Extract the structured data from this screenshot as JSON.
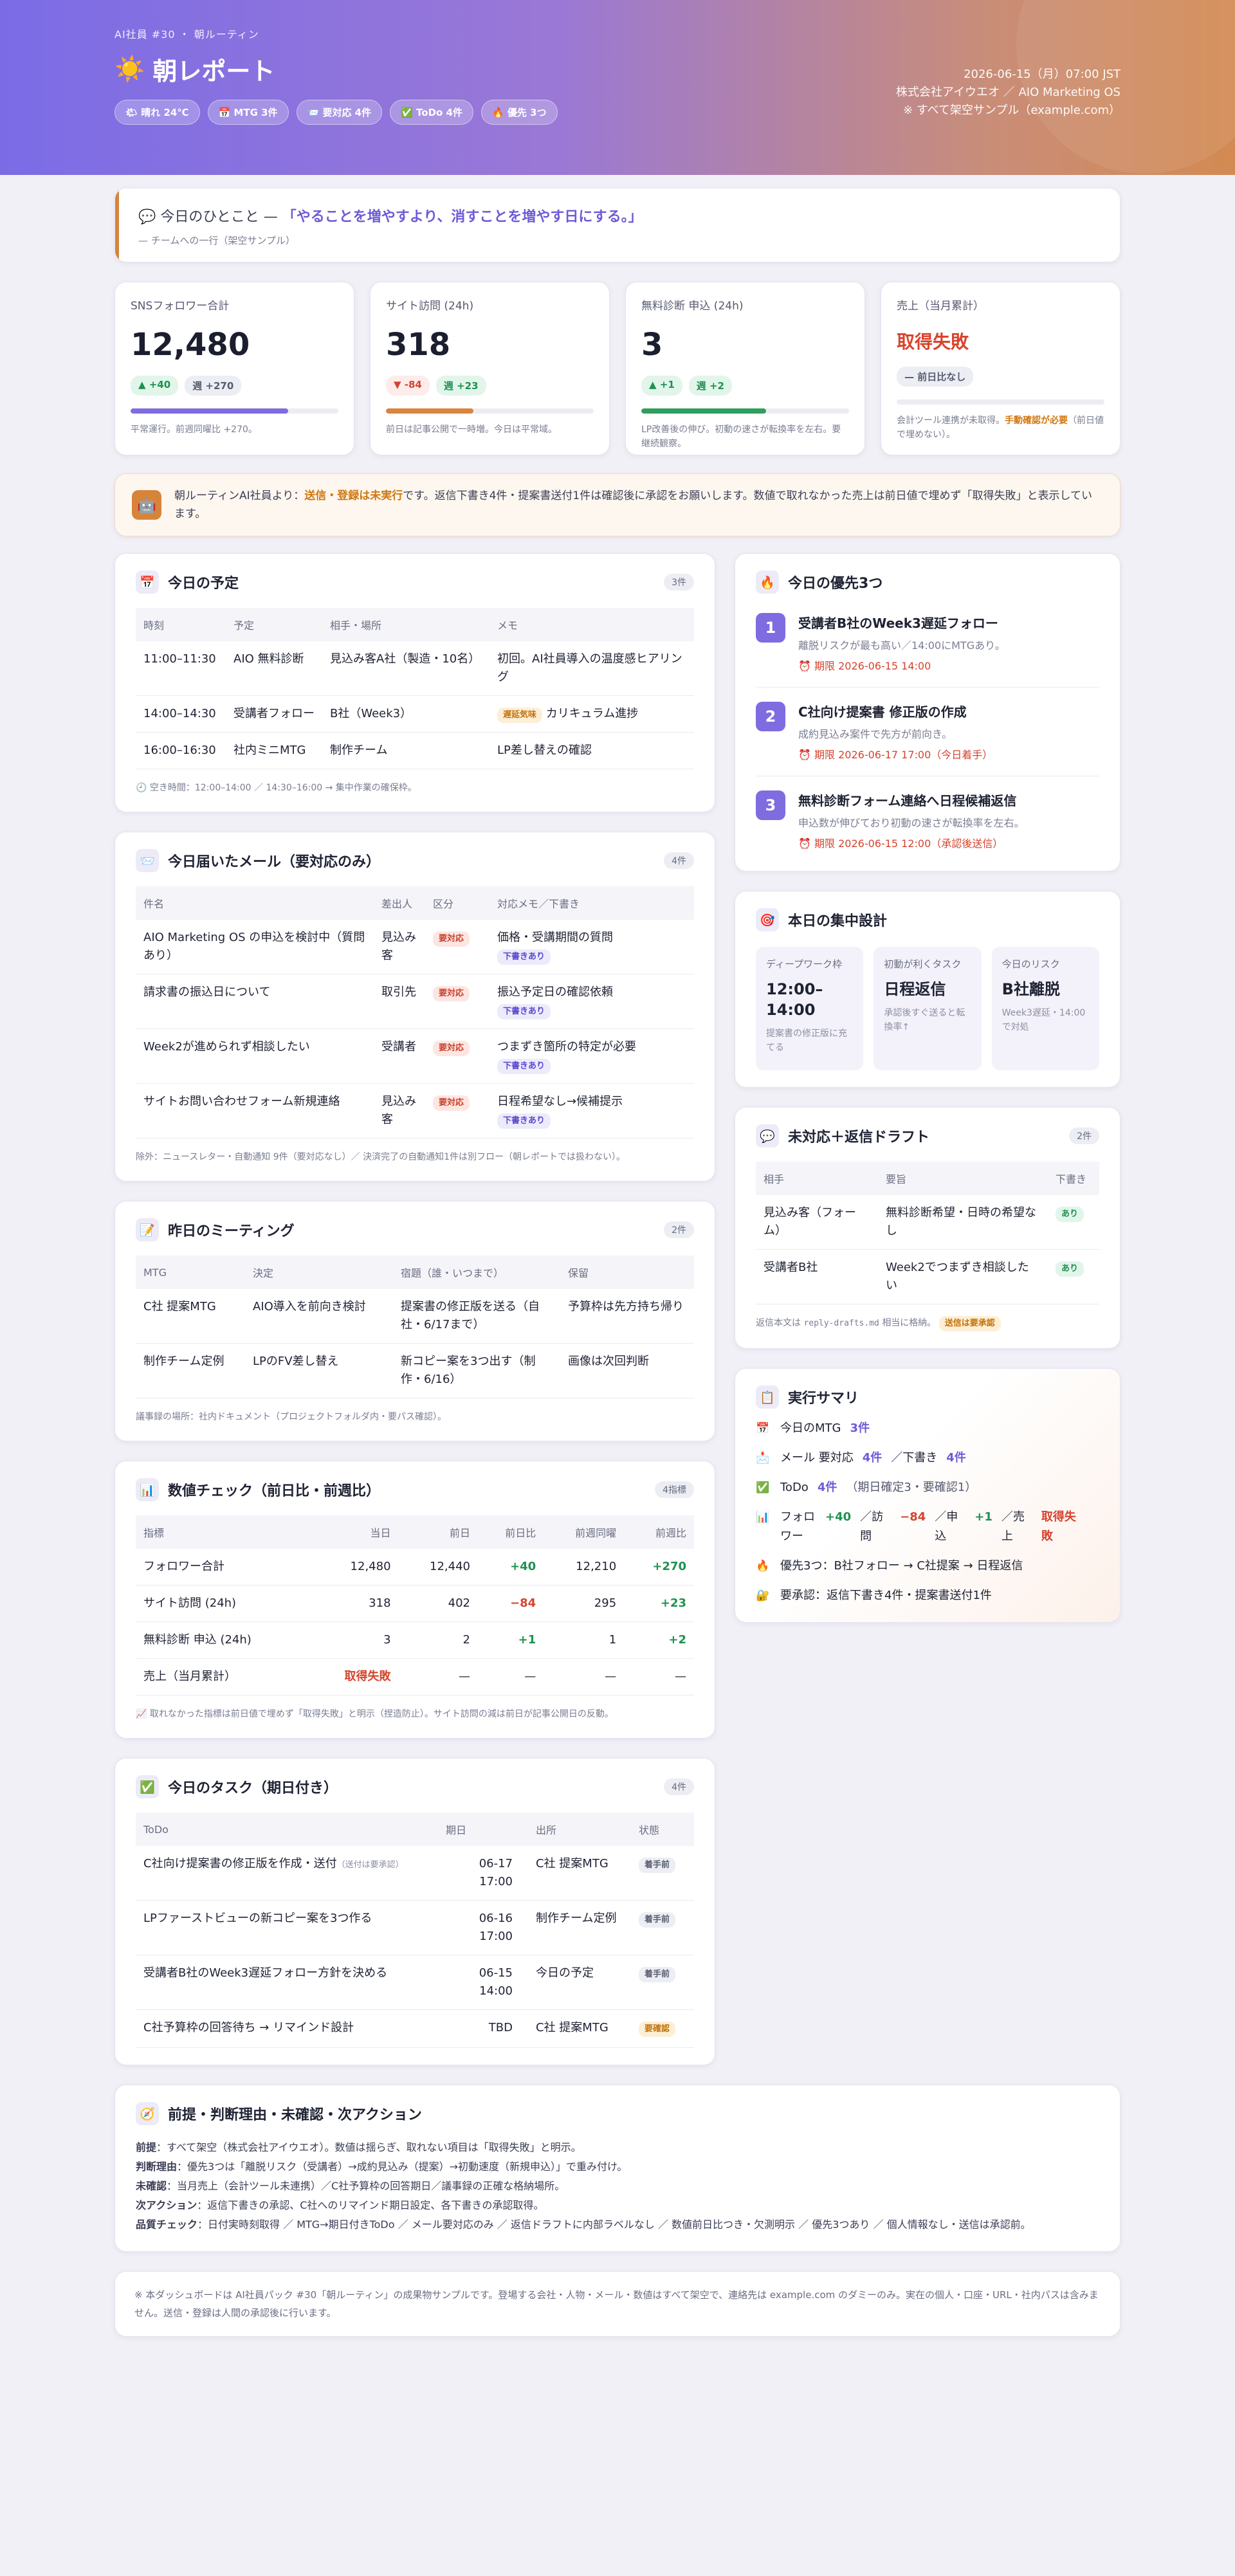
{
  "hero": {
    "eyebrow": "AI社員 #30 ・ 朝ルーティン",
    "title_icon": "☀️",
    "title": "朝レポート",
    "chips": [
      "🌤 晴れ 24℃",
      "📅 MTG 3件",
      "📨 要対応 4件",
      "✅ ToDo 4件",
      "🔥 優先 3つ"
    ],
    "meta": [
      "2026-06-15（月）07:00 JST",
      "株式会社アイウエオ ／ AIO Marketing OS",
      "※ すべて架空サンプル（example.com）"
    ]
  },
  "quote": {
    "lead": "💬 今日のひとこと — ",
    "text": "「やることを増やすより、消すことを増やす日にする。」",
    "sub": "— チームへの一行（架空サンプル）"
  },
  "kpis": [
    {
      "label": "SNSフォロワー合計",
      "value": "12,480",
      "badge1": "▲ +40",
      "badge1_type": "up",
      "badge2": "週 +270",
      "bar_pct": 76,
      "bar_color": "#7e6ce0",
      "note": "平常運行。前週同曜比 +270。"
    },
    {
      "label": "サイト訪問 (24h)",
      "value": "318",
      "badge1": "▼ -84",
      "badge1_type": "down",
      "badge2": "週 +23",
      "bar_pct": 42,
      "bar_color": "#d9843f",
      "note": "前日は記事公開で一時増。今日は平常域。"
    },
    {
      "label": "無料診断 申込 (24h)",
      "value": "3",
      "badge1": "▲ +1",
      "badge1_type": "up",
      "badge2": "週 +2",
      "bar_pct": 60,
      "bar_color": "#2f9e5e",
      "note": "LP改善後の伸び。初動の速さが転換率を左右。要継続観察。"
    },
    {
      "label": "売上（当月累計）",
      "value": "取得失敗",
      "badge1": "— 前日比なし",
      "bar_pct": 0,
      "bar_color": "#cccccc",
      "note_pre": "会計ツール連携が未取得。",
      "note_bold": "手動確認が必要",
      "note_post": "（前日値で埋めない）。"
    }
  ],
  "notice": {
    "icon": "🤖",
    "pre": "朝ルーティンAI社員より：",
    "bold": "送信・登録は未実行",
    "post": "です。返信下書き4件・提案書送付1件は確認後に承認をお願いします。数値で取れなかった売上は前日値で埋めず「取得失敗」と表示しています。"
  },
  "schedule": {
    "icon": "📅",
    "title": "今日の予定",
    "count": "3件",
    "headers": [
      "時刻",
      "予定",
      "相手・場所",
      "メモ"
    ],
    "rows": [
      {
        "time": "11:00–11:30",
        "event": "AIO 無料診断",
        "who": "見込み客A社（製造・10名）",
        "tag": "",
        "memo": "初回。AI社員導入の温度感ヒアリング"
      },
      {
        "time": "14:00–14:30",
        "event": "受講者フォロー",
        "who": "B社（Week3）",
        "tag": "遅延気味",
        "memo": "カリキュラム進捗"
      },
      {
        "time": "16:00–16:30",
        "event": "社内ミニMTG",
        "who": "制作チーム",
        "tag": "",
        "memo": "LP差し替えの確認"
      }
    ],
    "footnote": "🕘 空き時間：12:00–14:00 ／ 14:30–16:00 → 集中作業の確保枠。"
  },
  "mail": {
    "icon": "📨",
    "title": "今日届いたメール（要対応のみ）",
    "count": "4件",
    "headers": [
      "件名",
      "差出人",
      "区分",
      "対応メモ／下書き"
    ],
    "rows": [
      {
        "subject": "AIO Marketing OS の申込を検討中（質問あり）",
        "from": "見込み客",
        "kind": "要対応",
        "memo": "価格・受講期間の質問",
        "draft": "下書きあり"
      },
      {
        "subject": "請求書の振込日について",
        "from": "取引先",
        "kind": "要対応",
        "memo": "振込予定日の確認依頼",
        "draft": "下書きあり"
      },
      {
        "subject": "Week2が進められず相談したい",
        "from": "受講者",
        "kind": "要対応",
        "memo": "つまずき箇所の特定が必要",
        "draft": "下書きあり"
      },
      {
        "subject": "サイトお問い合わせフォーム新規連絡",
        "from": "見込み客",
        "kind": "要対応",
        "memo": "日程希望なし→候補提示",
        "draft": "下書きあり"
      }
    ],
    "footnote": "除外：ニュースレター・自動通知 9件（要対応なし）／ 決済完了の自動通知1件は別フロー（朝レポートでは扱わない）。"
  },
  "meetings": {
    "icon": "📝",
    "title": "昨日のミーティング",
    "count": "2件",
    "headers": [
      "MTG",
      "決定",
      "宿題（誰・いつまで）",
      "保留"
    ],
    "rows": [
      {
        "mtg": "C社 提案MTG",
        "decision": "AIO導入を前向き検討",
        "homework": "提案書の修正版を送る（自社・6/17まで）",
        "hold": "予算枠は先方持ち帰り"
      },
      {
        "mtg": "制作チーム定例",
        "decision": "LPのFV差し替え",
        "homework": "新コピー案を3つ出す（制作・6/16）",
        "hold": "画像は次回判断"
      }
    ],
    "footnote": "議事録の場所：社内ドキュメント（プロジェクトフォルダ内・要パス確認）。"
  },
  "metrics": {
    "icon": "📊",
    "title": "数値チェック（前日比・前週比）",
    "count": "4指標",
    "headers": [
      "指標",
      "当日",
      "前日",
      "前日比",
      "前週同曜",
      "前週比"
    ],
    "rows": [
      {
        "name": "フォロワー合計",
        "today": "12,480",
        "prev": "12,440",
        "dd": "+40",
        "dd_c": "g",
        "week": "12,210",
        "ww": "+270",
        "ww_c": "g"
      },
      {
        "name": "サイト訪問 (24h)",
        "today": "318",
        "prev": "402",
        "dd": "−84",
        "dd_c": "r",
        "week": "295",
        "ww": "+23",
        "ww_c": "g"
      },
      {
        "name": "無料診断 申込 (24h)",
        "today": "3",
        "prev": "2",
        "dd": "+1",
        "dd_c": "g",
        "week": "1",
        "ww": "+2",
        "ww_c": "g"
      },
      {
        "name": "売上（当月累計）",
        "today": "取得失敗",
        "today_c": "r",
        "prev": "—",
        "dd": "—",
        "dd_c": "",
        "week": "—",
        "ww": "—",
        "ww_c": ""
      }
    ],
    "footnote": "📈 取れなかった指標は前日値で埋めず「取得失敗」と明示（捏造防止）。サイト訪問の減は前日が記事公開日の反動。"
  },
  "tasks": {
    "icon": "✅",
    "title": "今日のタスク（期日付き）",
    "count": "4件",
    "headers": [
      "ToDo",
      "期日",
      "出所",
      "状態"
    ],
    "rows": [
      {
        "todo": "C社向け提案書の修正版を作成・送付",
        "todo_sub": "（送付は要承認）",
        "due": "06-17 17:00",
        "src": "C社 提案MTG",
        "state": "着手前",
        "state_c": "s"
      },
      {
        "todo": "LPファーストビューの新コピー案を3つ作る",
        "todo_sub": "",
        "due": "06-16 17:00",
        "src": "制作チーム定例",
        "state": "着手前",
        "state_c": "s"
      },
      {
        "todo": "受講者B社のWeek3遅延フォロー方針を決める",
        "todo_sub": "",
        "due": "06-15 14:00",
        "src": "今日の予定",
        "state": "着手前",
        "state_c": "s"
      },
      {
        "todo": "C社予算枠の回答待ち → リマインド設計",
        "todo_sub": "",
        "due": "TBD",
        "src": "C社 提案MTG",
        "state": "要確認",
        "state_c": "y"
      }
    ]
  },
  "priorities": {
    "icon": "🔥",
    "title": "今日の優先3つ",
    "items": [
      {
        "num": "1",
        "title": "受講者B社のWeek3遅延フォロー",
        "desc": "離脱リスクが最も高い／14:00にMTGあり。",
        "limit": "⏰ 期限 2026-06-15 14:00"
      },
      {
        "num": "2",
        "title": "C社向け提案書 修正版の作成",
        "desc": "成約見込み案件で先方が前向き。",
        "limit": "⏰ 期限 2026-06-17 17:00（今日着手）"
      },
      {
        "num": "3",
        "title": "無料診断フォーム連絡へ日程候補返信",
        "desc": "申込数が伸びており初動の速さが転換率を左右。",
        "limit": "⏰ 期限 2026-06-15 12:00（承認後送信）"
      }
    ]
  },
  "focus": {
    "icon": "🎯",
    "title": "本日の集中設計",
    "boxes": [
      {
        "label": "ディープワーク枠",
        "value": "12:00–14:00",
        "note": "提案書の修正版に充てる"
      },
      {
        "label": "初動が利くタスク",
        "value": "日程返信",
        "note": "承認後すぐ送ると転換率↑"
      },
      {
        "label": "今日のリスク",
        "value": "B社離脱",
        "note": "Week3遅延・14:00で対処"
      }
    ]
  },
  "drafts": {
    "icon": "💬",
    "title": "未対応＋返信ドラフト",
    "count": "2件",
    "headers": [
      "相手",
      "要旨",
      "下書き"
    ],
    "rows": [
      {
        "who": "見込み客（フォーム）",
        "gist": "無料診断希望・日時の希望なし",
        "draft": "あり"
      },
      {
        "who": "受講者B社",
        "gist": "Week2でつまずき相談したい",
        "draft": "あり"
      }
    ],
    "foot_pre": "返信本文は",
    "foot_mono": "reply-drafts.md",
    "foot_post": "相当に格納。",
    "foot_tag": "送信は要承認"
  },
  "summary": {
    "icon": "📋",
    "title": "実行サマリ",
    "mtg": {
      "icon": "📅",
      "label": "今日のMTG",
      "value": "3件"
    },
    "mail": {
      "icon": "📩",
      "label": "メール 要対応",
      "value": "4件",
      "label2": "／下書き",
      "value2": "4件"
    },
    "todo": {
      "icon": "✅",
      "label": "ToDo",
      "value": "4件",
      "note": "（期日確定3・要確認1）"
    },
    "num": {
      "icon": "📊",
      "l1": "フォロワー",
      "v1": "+40",
      "l2": "／訪問",
      "v2": "−84",
      "l3": "／申込",
      "v3": "+1",
      "l4": "／売上",
      "v4": "取得失敗"
    },
    "prio": {
      "icon": "🔥",
      "text": "優先3つ：B社フォロー → C社提案 → 日程返信"
    },
    "appr": {
      "icon": "🔐",
      "text": "要承認：返信下書き4件・提案書送付1件"
    }
  },
  "bottom": {
    "icon": "🧭",
    "title": "前提・判断理由・未確認・次アクション",
    "lines": [
      {
        "label": "前提",
        "text": "：すべて架空（株式会社アイウエオ）。数値は揺らぎ、取れない項目は「取得失敗」と明示。"
      },
      {
        "label": "判断理由",
        "text": "：優先3つは「離脱リスク（受講者）→成約見込み（提案）→初動速度（新規申込）」で重み付け。"
      },
      {
        "label": "未確認",
        "text": "：当月売上（会計ツール未連携）／C社予算枠の回答期日／議事録の正確な格納場所。"
      },
      {
        "label": "次アクション",
        "text": "：返信下書きの承認、C社へのリマインド期日設定、各下書きの承認取得。"
      },
      {
        "label": "品質チェック",
        "text": "：日付実時刻取得 ／ MTG→期日付きToDo ／ メール要対応のみ ／ 返信ドラフトに内部ラベルなし ／ 数値前日比つき・欠測明示 ／ 優先3つあり ／ 個人情報なし・送信は承認前。"
      }
    ]
  },
  "disclaimer": "※ 本ダッシュボードは AI社員パック #30「朝ルーティン」の成果物サンプルです。登場する会社・人物・メール・数値はすべて架空で、連絡先は example.com のダミーのみ。実在の個人・口座・URL・社内パスは含みません。送信・登録は人間の承認後に行います。"
}
